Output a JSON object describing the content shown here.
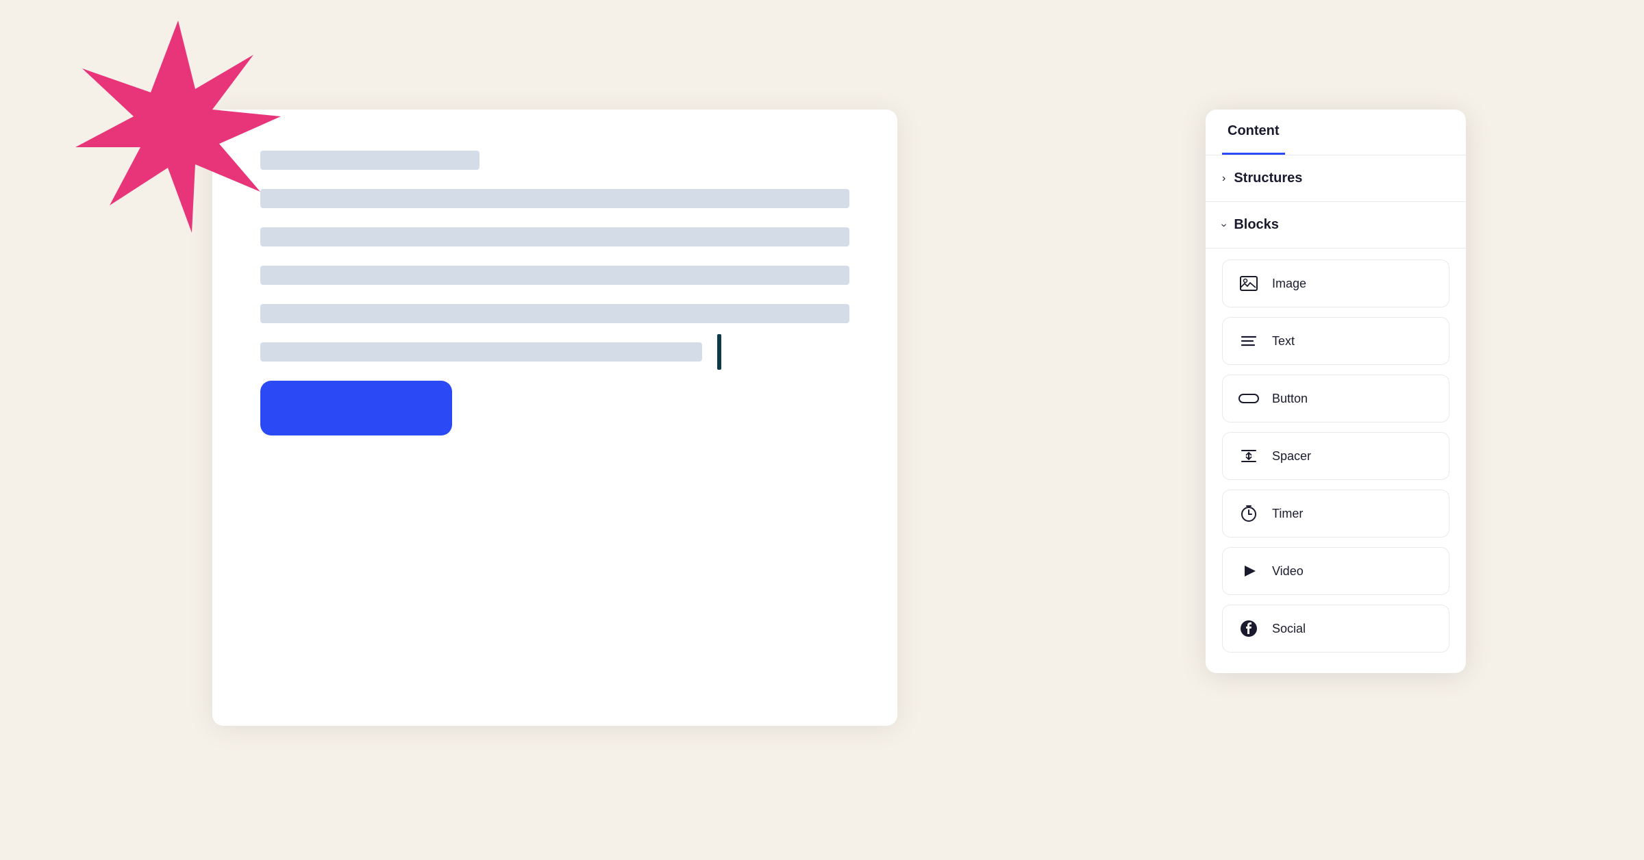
{
  "background_color": "#f5f0e8",
  "star": {
    "color": "#e8357a"
  },
  "panel": {
    "tabs": [
      {
        "id": "content",
        "label": "Content",
        "active": true
      }
    ],
    "sections": [
      {
        "id": "structures",
        "label": "Structures",
        "collapsed": true,
        "chevron": "›"
      },
      {
        "id": "blocks",
        "label": "Blocks",
        "collapsed": false,
        "chevron": "‹"
      }
    ],
    "blocks": [
      {
        "id": "image",
        "label": "Image",
        "icon": "image-icon"
      },
      {
        "id": "text",
        "label": "Text",
        "icon": "text-icon"
      },
      {
        "id": "button",
        "label": "Button",
        "icon": "button-icon"
      },
      {
        "id": "spacer",
        "label": "Spacer",
        "icon": "spacer-icon"
      },
      {
        "id": "timer",
        "label": "Timer",
        "icon": "timer-icon"
      },
      {
        "id": "video",
        "label": "Video",
        "icon": "video-icon"
      },
      {
        "id": "social",
        "label": "Social",
        "icon": "social-icon"
      }
    ]
  }
}
